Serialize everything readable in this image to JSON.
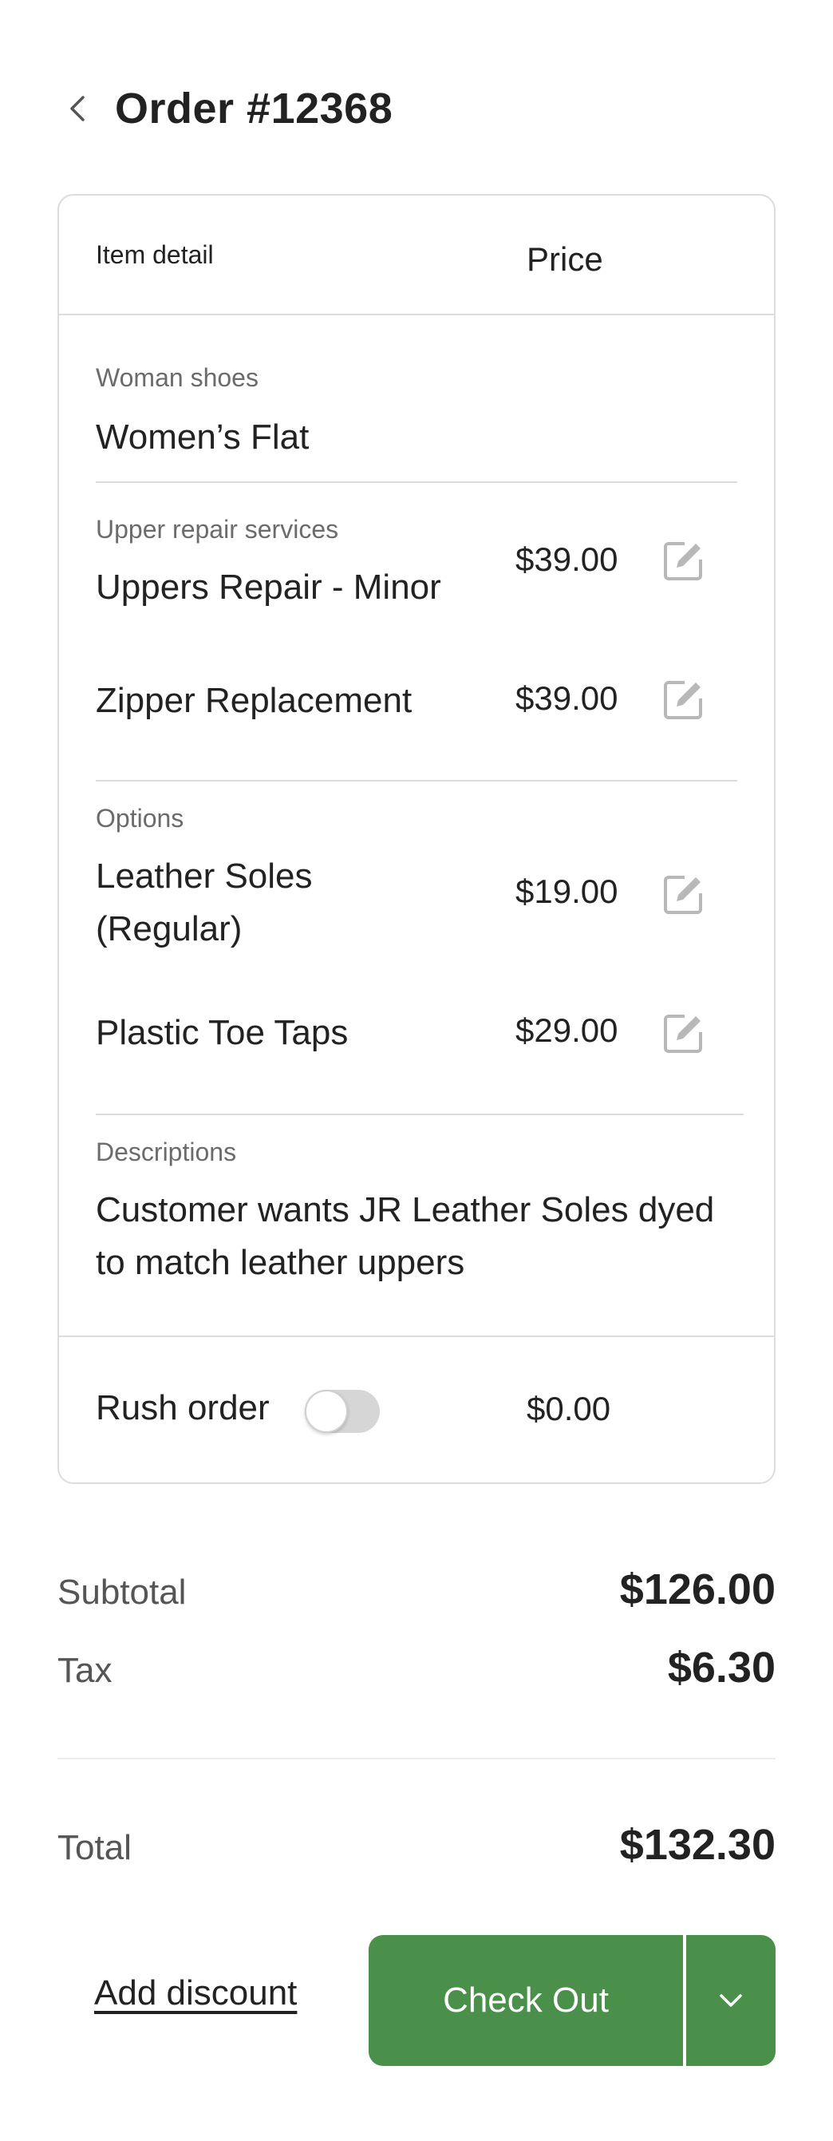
{
  "header": {
    "title": "Order #12368",
    "back_icon": "chevron-left-icon"
  },
  "table": {
    "col_item": "Item detail",
    "col_price": "Price"
  },
  "shoe": {
    "group_label": "Woman shoes",
    "name": "Women’s Flat"
  },
  "upper_repair": {
    "group_label": "Upper repair services",
    "items": [
      {
        "name": "Uppers Repair - Minor",
        "price": "$39.00"
      },
      {
        "name": "Zipper Replacement",
        "price": "$39.00"
      }
    ]
  },
  "options": {
    "group_label": "Options",
    "items": [
      {
        "name": "Leather Soles (Regular)",
        "price": "$19.00"
      },
      {
        "name": "Plastic Toe Taps",
        "price": "$29.00"
      }
    ]
  },
  "descriptions": {
    "group_label": "Descriptions",
    "text": "Customer wants JR Leather Soles dyed to match leather uppers"
  },
  "rush": {
    "label": "Rush order",
    "enabled": false,
    "price": "$0.00"
  },
  "summary": {
    "subtotal_label": "Subtotal",
    "subtotal_value": "$126.00",
    "tax_label": "Tax",
    "tax_value": "$6.30",
    "total_label": "Total",
    "total_value": "$132.30"
  },
  "actions": {
    "discount_label": "Add discount",
    "checkout_label": "Check Out",
    "menu_icon": "chevron-down-icon"
  },
  "colors": {
    "primary": "#4a8f4a",
    "border": "#dcdcdc",
    "muted_text": "#6b6b6b",
    "edit_icon": "#b8b8b8"
  }
}
